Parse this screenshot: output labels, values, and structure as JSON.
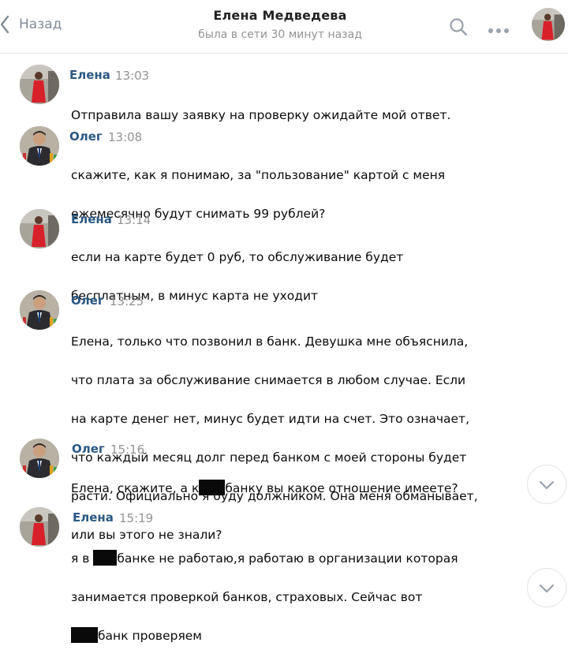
{
  "header": {
    "back_label": "Назад",
    "title": "Елена Медведева",
    "subtitle": "была в сети 30 минут назад",
    "search_icon": "search-icon",
    "more_icon": "more-dots-icon"
  },
  "messages": [
    {
      "author": "Елена",
      "time": "13:03",
      "lines": [
        "Отправила вашу заявку на проверку ожидайте мой ответ."
      ]
    },
    {
      "author": "Олег",
      "time": "13:08",
      "lines": [
        "скажите, как я понимаю, за \"пользование\" картой с меня",
        "ежемесячно будут снимать 99 рублей?"
      ]
    },
    {
      "author": "Елена",
      "time": "13:14",
      "lines": [
        "если на карте будет 0 руб, то обслуживание будет",
        "бесплатным, в минус карта не уходит"
      ]
    },
    {
      "author": "Олег",
      "time": "13:25",
      "lines": [
        "Елена, только что позвонил в банк. Девушка мне объяснила,",
        "что плата за обслуживание снимается в любом случае. Если",
        "на карте денег нет, минус будет идти на счет. Это означает,",
        "что каждый месяц долг перед банком с моей стороны будет",
        "расти. Официально я буду должником. Она меня обманывает,",
        "или вы этого не знали?"
      ]
    },
    {
      "author": "Олег",
      "time": "15:16",
      "pre": "Елена, скажите, а к",
      "post": "банку вы какое отношение имеете?"
    },
    {
      "author": "Елена",
      "time": "15:19",
      "l1_pre": "я в",
      "l1_post": "банке не работаю,я работаю в организации которая",
      "l2": "занимается проверкой банков, страховых. Сейчас вот",
      "l3_post": "банк проверяем"
    }
  ],
  "colors": {
    "name_link": "#2a5885",
    "time": "#939393",
    "muted": "#818c99"
  }
}
